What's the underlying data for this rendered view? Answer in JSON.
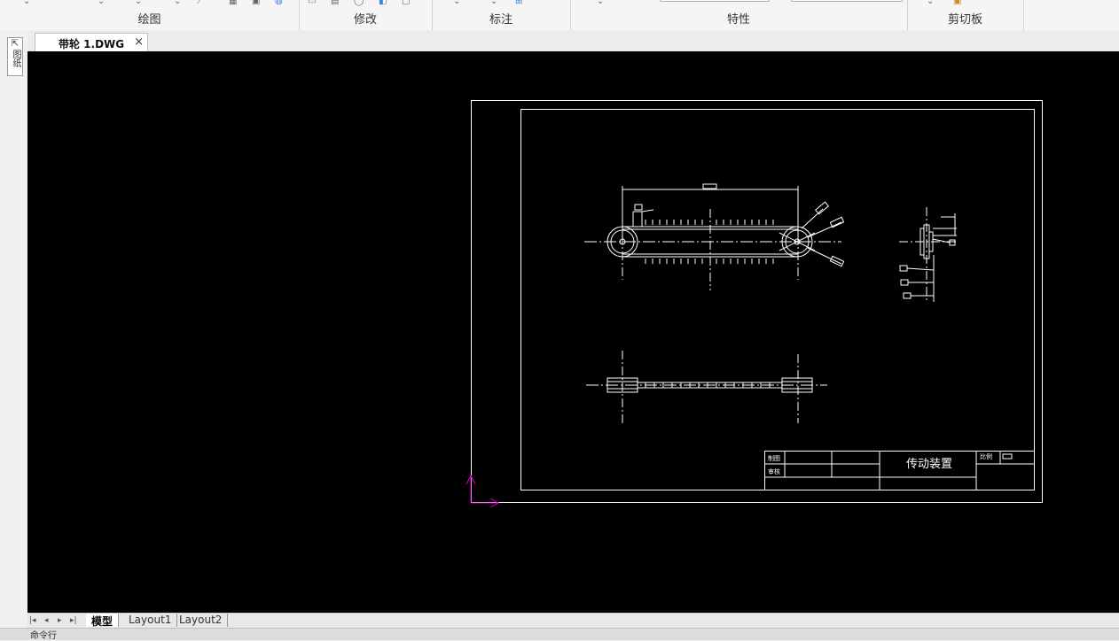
{
  "ribbon": {
    "groups": [
      {
        "label": "绘图"
      },
      {
        "label": "修改"
      },
      {
        "label": "标注"
      },
      {
        "label": "特性"
      },
      {
        "label": "剪切板"
      }
    ]
  },
  "left_toolbar": {
    "label": "图纸"
  },
  "document": {
    "tab_title": "带轮 1.DWG",
    "close_glyph": "×"
  },
  "drawing": {
    "title_block": {
      "drawn_label": "制图",
      "checked_label": "审核",
      "title": "传动装置",
      "scale_label": "比例"
    },
    "ucs_color": "#cc00cc",
    "line_color": "#ffffff"
  },
  "layout_tabs": [
    {
      "label": "模型",
      "active": true
    },
    {
      "label": "Layout1",
      "active": false
    },
    {
      "label": "Layout2",
      "active": false
    }
  ],
  "nav_buttons": [
    "|◂",
    "◂",
    "▸",
    "▸|"
  ],
  "command": {
    "prompt": "命令行"
  }
}
